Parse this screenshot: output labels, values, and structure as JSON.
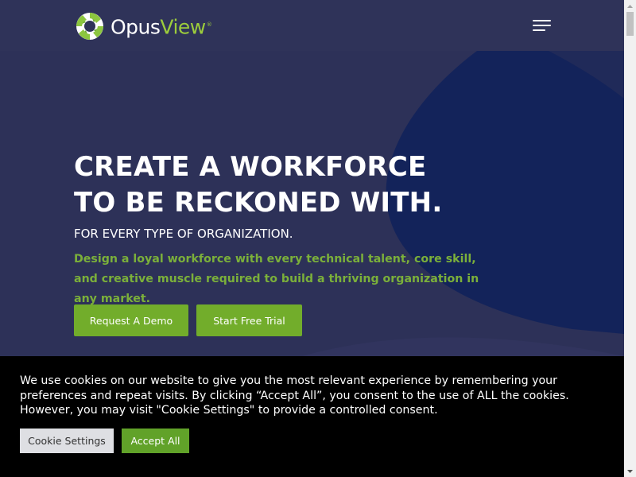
{
  "header": {
    "brand_main": "Opus",
    "brand_accent": "View",
    "brand_mark": "®",
    "menu_icon": "hamburger-menu-icon"
  },
  "hero": {
    "title_line1": "CREATE A WORKFORCE",
    "title_line2": "TO BE RECKONED WITH.",
    "subtitle": "FOR EVERY TYPE OF ORGANIZATION.",
    "description": "Design a loyal workforce with every technical talent, core skill, and creative muscle required to build a thriving organization in any market.",
    "demo_label": "Request A Demo",
    "trial_label": "Start Free Trial"
  },
  "cookie": {
    "message": "We use cookies on our website to give you the most relevant experience by remembering your preferences and repeat visits. By clicking “Accept All”, you consent to the use of ALL the cookies. However, you may visit \"Cookie Settings\" to provide a controlled consent.",
    "settings_label": "Cookie Settings",
    "accept_label": "Accept All"
  },
  "colors": {
    "header_bg": "#2f3359",
    "hero_bg": "#2d3158",
    "hero_shape": "#13235a",
    "accent_green": "#72ad2b",
    "text_green": "#7bb03a",
    "cookie_bg": "#000000"
  }
}
